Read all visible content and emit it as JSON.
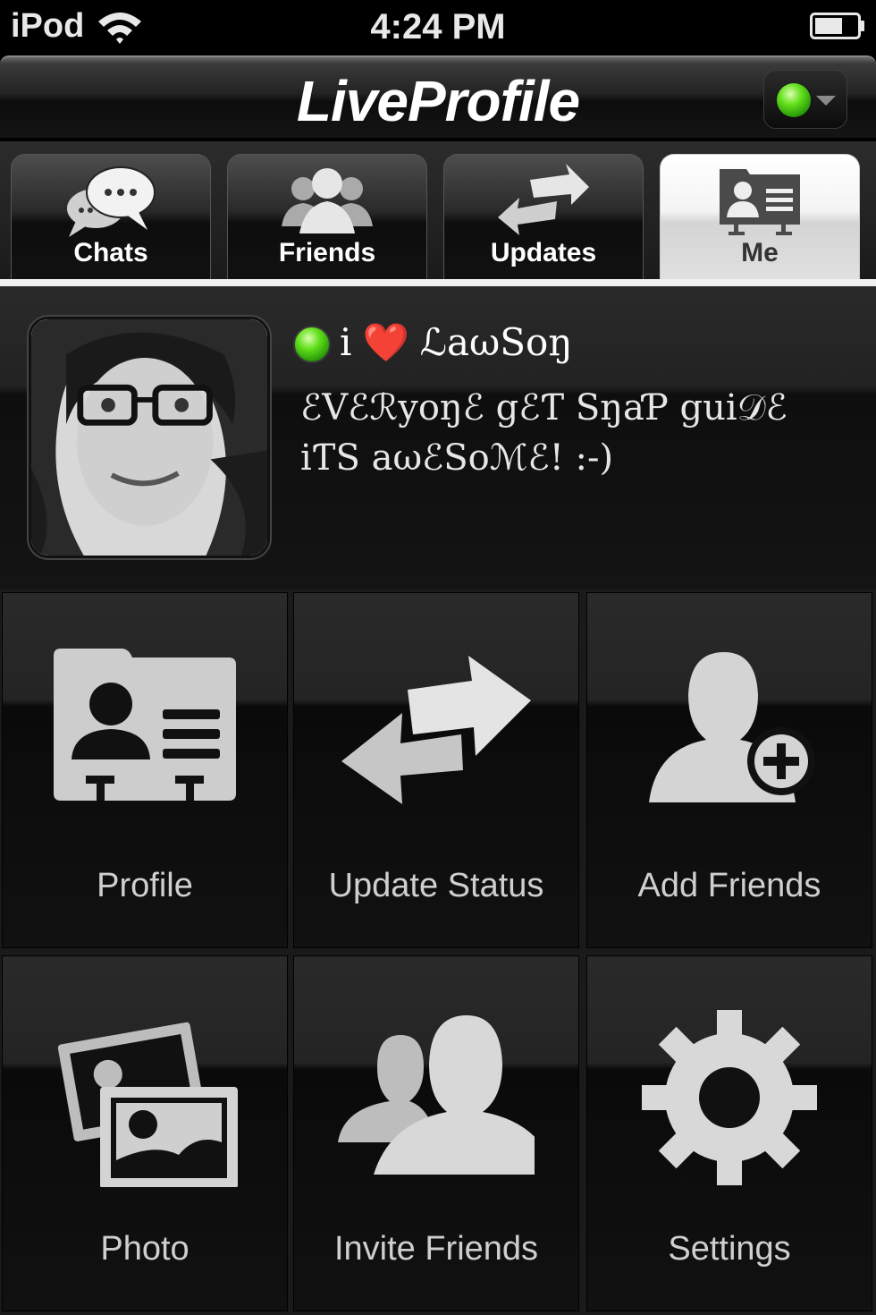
{
  "status_bar": {
    "carrier": "iPod",
    "time": "4:24 PM"
  },
  "title_bar": {
    "title": "LiveProfile",
    "presence_color": "#4fd21a"
  },
  "tabs": [
    {
      "label": "Chats",
      "icon": "chat-bubbles-icon",
      "active": false
    },
    {
      "label": "Friends",
      "icon": "friends-icon",
      "active": false
    },
    {
      "label": "Updates",
      "icon": "updates-arrows-icon",
      "active": false
    },
    {
      "label": "Me",
      "icon": "contact-card-icon",
      "active": true
    }
  ],
  "profile": {
    "name_prefix": "i",
    "heart": "❤️",
    "name": "ℒaωSoŋ",
    "status_message": "ℰVℰℛyoŋℰ gℰƬ SŋaƤ gui𝒟ℰ iƬS aωℰSoℳℰ! :-)"
  },
  "menu": [
    {
      "label": "Profile",
      "icon": "contact-card-icon"
    },
    {
      "label": "Update Status",
      "icon": "updates-arrows-icon"
    },
    {
      "label": "Add Friends",
      "icon": "add-friend-icon"
    },
    {
      "label": "Photo",
      "icon": "photos-icon"
    },
    {
      "label": "Invite Friends",
      "icon": "invite-friends-icon"
    },
    {
      "label": "Settings",
      "icon": "gear-icon"
    }
  ],
  "colors": {
    "accent_green": "#4fd21a",
    "heart_red": "#e1262c",
    "icon_gray": "#c8c8c8"
  }
}
